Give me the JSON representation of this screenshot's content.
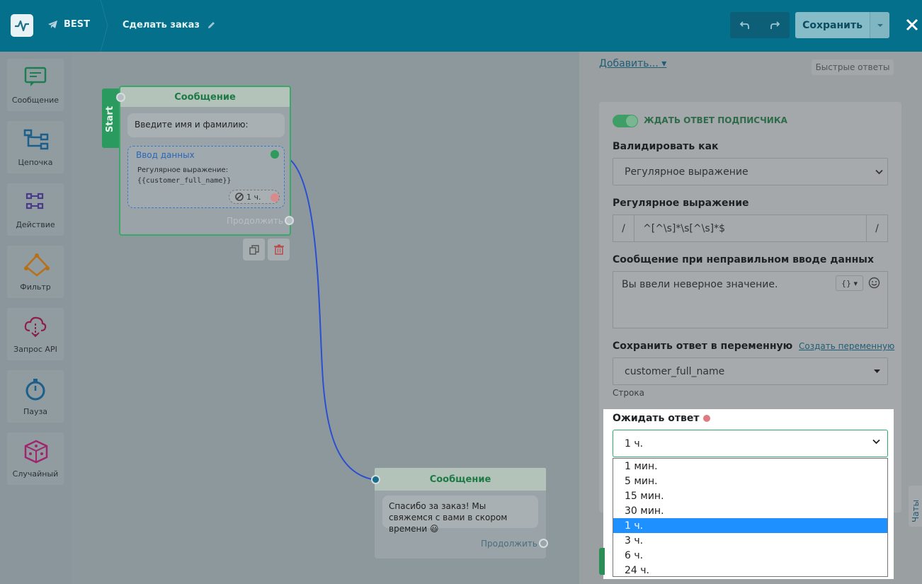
{
  "header": {
    "bot_name": "BEST",
    "flow_title": "Сделать заказ",
    "save_label": "Сохранить"
  },
  "toolbar": {
    "items": [
      {
        "label": "Сообщение",
        "icon": "message-icon"
      },
      {
        "label": "Цепочка",
        "icon": "chain-icon"
      },
      {
        "label": "Действие",
        "icon": "action-icon"
      },
      {
        "label": "Фильтр",
        "icon": "filter-icon"
      },
      {
        "label": "Запрос API",
        "icon": "api-icon"
      },
      {
        "label": "Пауза",
        "icon": "timer-icon"
      },
      {
        "label": "Случайный",
        "icon": "dice-icon"
      }
    ]
  },
  "canvas": {
    "start_label": "Start",
    "node1": {
      "title": "Сообщение",
      "text": "Введите имя и фамилию:",
      "input_title": "Ввод данных",
      "input_desc_line1": "Регулярное выражение:",
      "input_desc_line2": "{{customer_full_name}}",
      "timer": "1 ч.",
      "continue": "Продолжить"
    },
    "node2": {
      "title": "Сообщение",
      "text": "Спасибо за заказ! Мы свяжемся с вами в скором времени 😃",
      "continue": "Продолжить"
    }
  },
  "panel": {
    "add_label": "Добавить...",
    "quick_replies": "Быстрые ответы",
    "wait_reply": "ЖДАТЬ ОТВЕТ ПОДПИСЧИКА",
    "validate_label": "Валидировать как",
    "validate_value": "Регулярное выражение",
    "regex_label": "Регулярное выражение",
    "regex_value": "^[^\\s]*\\s[^\\s]*$",
    "error_msg_label": "Сообщение при неправильном вводе данных",
    "error_msg_value": "Вы ввели неверное значение.",
    "var_btn": "{}",
    "save_var_label": "Сохранить ответ в переменную",
    "create_var": "Создать переменную",
    "var_value": "customer_full_name",
    "var_type": "Строка",
    "wait_time_label": "Ожидать ответ",
    "wait_time_value": "1 ч.",
    "options": [
      "1 мин.",
      "5 мин.",
      "15 мин.",
      "30 мин.",
      "1 ч.",
      "3 ч.",
      "6 ч.",
      "24 ч."
    ],
    "selected_index": 4,
    "chats_tab": "Чаты"
  },
  "colors": {
    "header": "#04708c",
    "accent_green": "#2eaa6a",
    "selection": "#1e90ff"
  }
}
